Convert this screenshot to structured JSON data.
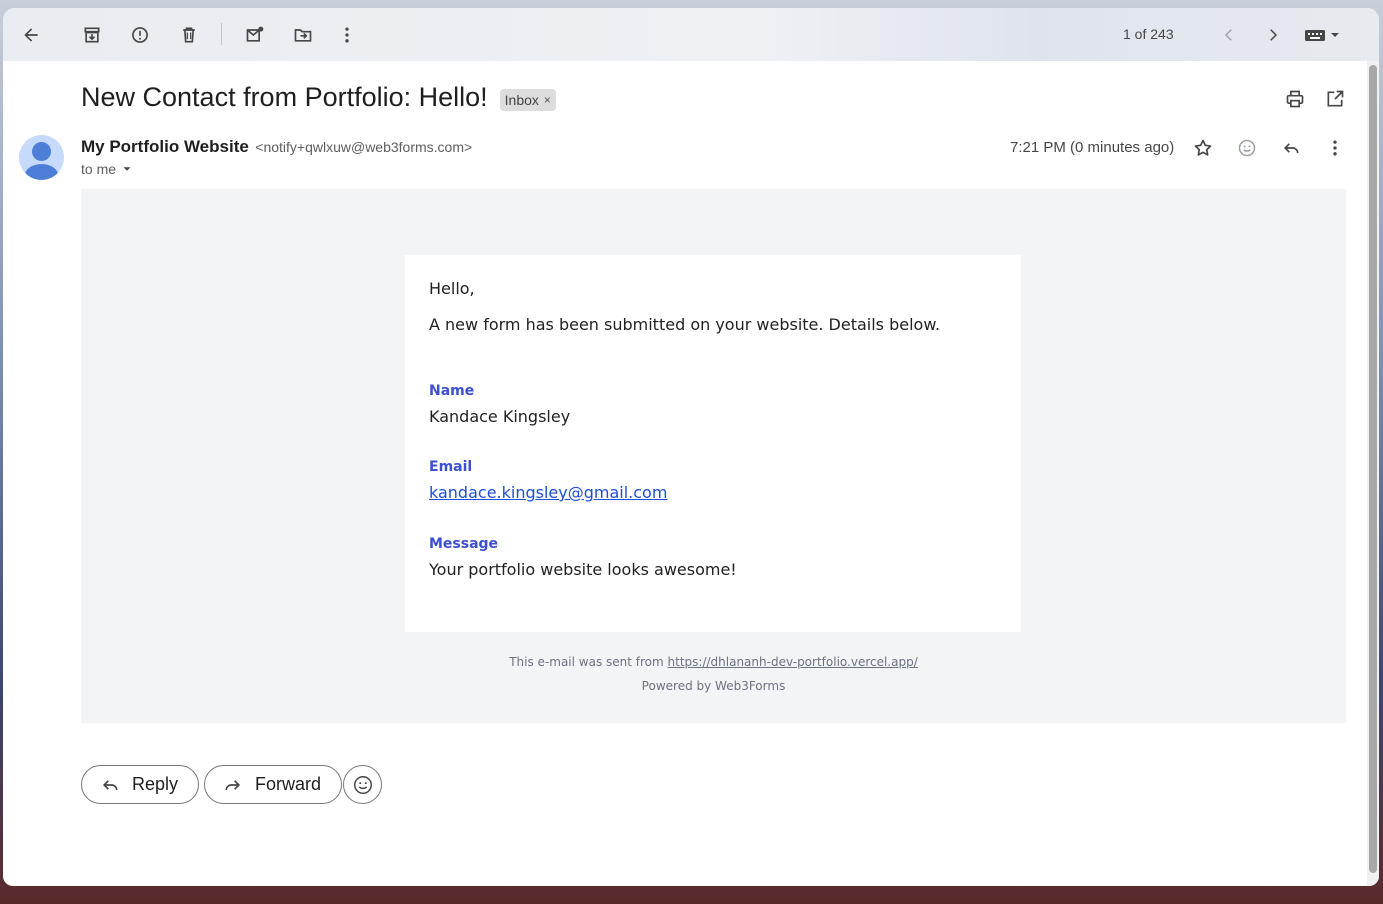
{
  "toolbar": {
    "icons": [
      "back-arrow-icon",
      "archive-icon",
      "report-spam-icon",
      "delete-icon",
      "mark-unread-icon",
      "move-to-icon",
      "more-vert-icon"
    ],
    "pager_text": "1 of 243",
    "nav": [
      "chevron-left-icon",
      "chevron-right-icon",
      "keyboard-icon"
    ]
  },
  "message": {
    "subject": "New Contact from Portfolio: Hello!",
    "label": "Inbox",
    "label_remove": "×",
    "sender_name": "My Portfolio Website",
    "sender_email": "<notify+qwlxuw@web3forms.com>",
    "to": "to me",
    "time": "7:21 PM (0 minutes ago)"
  },
  "body": {
    "greeting": "Hello,",
    "intro": "A new form has been submitted on your website. Details below.",
    "fields": [
      {
        "label": "Name",
        "value": "Kandace Kingsley"
      },
      {
        "label": "Email",
        "value": "kandace.kingsley@gmail.com"
      },
      {
        "label": "Message",
        "value": "Your portfolio website looks awesome!"
      }
    ],
    "footer_prefix": "This e-mail was sent from ",
    "footer_link": "https://dhlananh-dev-portfolio.vercel.app/",
    "powered_by": "Powered by Web3Forms"
  },
  "actions": {
    "reply": "Reply",
    "forward": "Forward"
  },
  "colors": {
    "field_label": "#3b4fd1",
    "link": "#1d4ed8",
    "body_bg": "#f3f4f6"
  }
}
